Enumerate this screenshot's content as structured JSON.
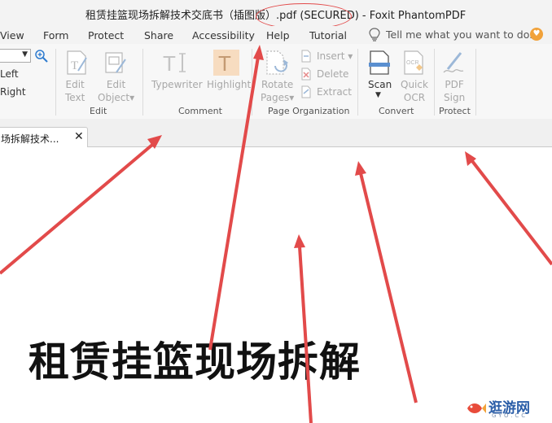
{
  "window": {
    "title": "租赁挂篮现场拆解技术交底书（插图版）.pdf (SECURED) - Foxit PhantomPDF"
  },
  "menu": {
    "items": [
      "View",
      "Form",
      "Protect",
      "Share",
      "Accessibility",
      "Help",
      "Tutorial"
    ],
    "tell_me": "Tell me what you want to do.."
  },
  "ribbon": {
    "left_partial": {
      "align_left": "Left",
      "align_right": "Right"
    },
    "edit": {
      "label": "Edit",
      "edit_text": "Edit\nText",
      "edit_object": "Edit\nObject▾"
    },
    "comment": {
      "label": "Comment",
      "typewriter": "Typewriter",
      "highlight": "Highlight"
    },
    "page_organization": {
      "label": "Page Organization",
      "rotate_pages": "Rotate\nPages▾",
      "insert": "Insert ▾",
      "delete": "Delete",
      "extract": "Extract"
    },
    "convert": {
      "label": "Convert",
      "scan": "Scan",
      "quick_ocr": "Quick\nOCR"
    },
    "protect": {
      "label": "Protect",
      "pdf_sign": "PDF\nSign"
    }
  },
  "tabs": {
    "document_tab": "场拆解技术..."
  },
  "document": {
    "heading": "租赁挂篮现场拆解"
  },
  "watermark": {
    "text": "逛游网",
    "sub": "GYO.CC"
  },
  "colors": {
    "annotation_red": "#e24a4a",
    "ribbon_bg": "#f7f7f7",
    "menubar_bg": "#f3f3f3",
    "disabled_text": "#a8a8a8",
    "icon_blue": "#5a8fd0"
  }
}
